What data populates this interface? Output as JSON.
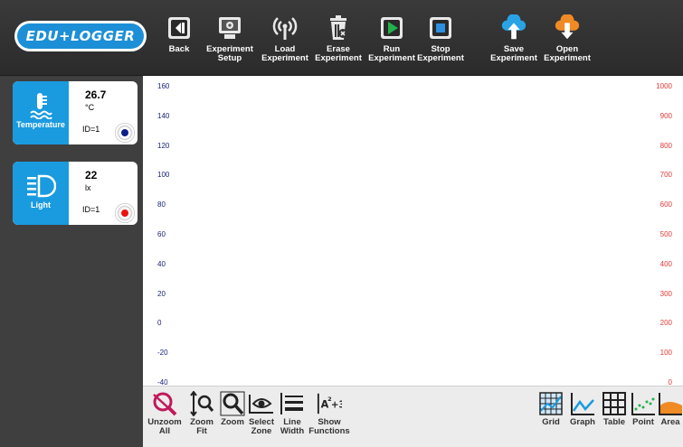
{
  "logo": {
    "text": "EDU+LOGGER"
  },
  "toolbar": {
    "back": "Back",
    "experiment_setup": "Experiment\nSetup",
    "load_experiment": "Load\nExperiment",
    "erase_experiment": "Erase\nExperiment",
    "run_experiment": "Run\nExperiment",
    "stop_experiment": "Stop\nExperiment",
    "save_experiment": "Save\nExperiment",
    "open_experiment": "Open\nExperiment"
  },
  "sensors": [
    {
      "name": "Temperature",
      "value": "26.7",
      "unit": "°C",
      "id": "ID=1",
      "dot_color": "#0b1e8c",
      "icon": "thermometer-icon"
    },
    {
      "name": "Light",
      "value": "22",
      "unit": "lx",
      "id": "ID=1",
      "dot_color": "#ee1111",
      "icon": "light-icon"
    }
  ],
  "graph": {
    "left_axis": [
      "160",
      "140",
      "120",
      "100",
      "80",
      "60",
      "40",
      "20",
      "0",
      "-20",
      "-40"
    ],
    "right_axis": [
      "1000",
      "900",
      "800",
      "700",
      "600",
      "500",
      "400",
      "300",
      "200",
      "100",
      "0"
    ],
    "left_color": "#1a237e",
    "right_color": "#e53935"
  },
  "bottom": {
    "unzoom_all": "Unzoom\nAll",
    "zoom_fit": "Zoom\nFit",
    "zoom": "Zoom",
    "select_zone": "Select\nZone",
    "line_width": "Line\nWidth",
    "show_functions": "Show\nFunctions",
    "grid": "Grid",
    "graph": "Graph",
    "table": "Table",
    "point": "Point",
    "area": "Area"
  },
  "colors": {
    "accent": "#1a9be0",
    "toolbar": "#333333",
    "cloud_save": "#29a3e6",
    "cloud_open": "#f08a24",
    "run": "#22b14c",
    "stop": "#2e8fe0"
  }
}
